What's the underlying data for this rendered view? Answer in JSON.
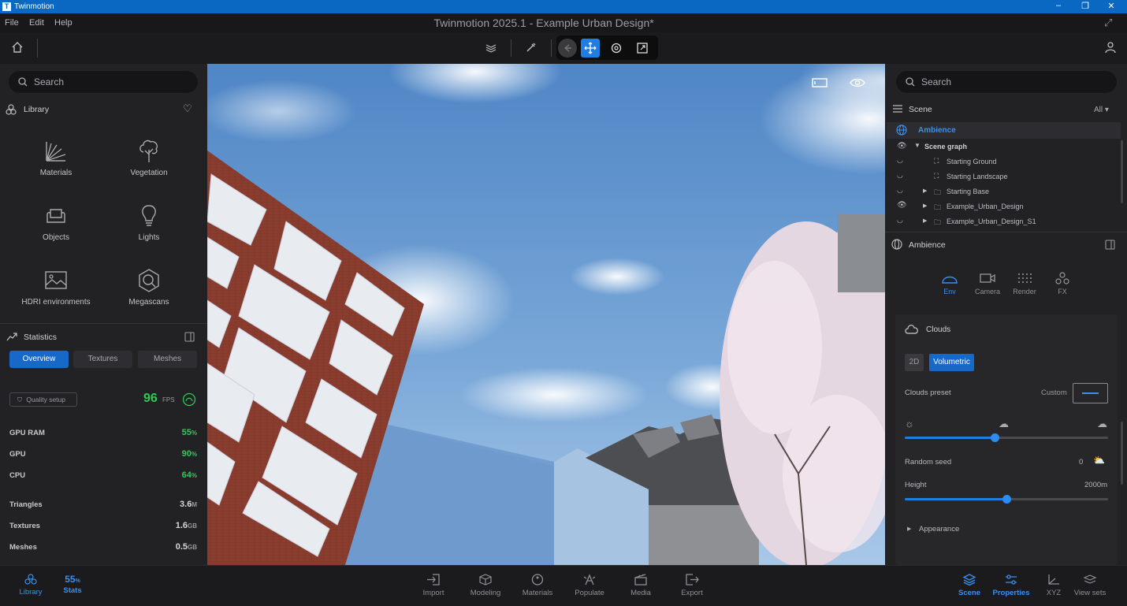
{
  "window": {
    "app_name": "Twinmotion",
    "document_title": "Twinmotion 2025.1 - Example Urban Design*"
  },
  "menu": [
    "File",
    "Edit",
    "Help"
  ],
  "left": {
    "search_placeholder": "Search",
    "library_title": "Library",
    "library_items": [
      "Materials",
      "Vegetation",
      "Objects",
      "Lights",
      "HDRI environments",
      "Megascans"
    ],
    "statistics_title": "Statistics",
    "tabs": [
      "Overview",
      "Textures",
      "Meshes"
    ],
    "quality_setup": "Quality setup",
    "fps_value": "96",
    "fps_unit": "FPS",
    "usage": [
      {
        "label": "GPU RAM",
        "value": "55",
        "unit": "%"
      },
      {
        "label": "GPU",
        "value": "90",
        "unit": "%"
      },
      {
        "label": "CPU",
        "value": "64",
        "unit": "%"
      }
    ],
    "counts": [
      {
        "label": "Triangles",
        "value": "3.6",
        "unit": "M"
      },
      {
        "label": "Textures",
        "value": "1.6",
        "unit": "GB"
      },
      {
        "label": "Meshes",
        "value": "0.5",
        "unit": "GB"
      }
    ]
  },
  "right": {
    "search_placeholder": "Search",
    "scene_title": "Scene",
    "filter": "All",
    "ambience_row": "Ambience",
    "tree": [
      "Scene graph",
      "Starting Ground",
      "Starting Landscape",
      "Starting Base",
      "Example_Urban_Design",
      "Example_Urban_Design_S1"
    ],
    "ambience_title": "Ambience",
    "prop_tabs": [
      "Env",
      "Camera",
      "Render",
      "FX"
    ],
    "clouds_title": "Clouds",
    "mode_2d": "2D",
    "mode_volumetric": "Volumetric",
    "clouds_preset_label": "Clouds preset",
    "clouds_preset_value": "Custom",
    "cloud_cover_fraction": 0.44,
    "random_seed_label": "Random seed",
    "random_seed_value": "0",
    "height_label": "Height",
    "height_value": "2000m",
    "height_fraction": 0.5,
    "appearance": "Appearance"
  },
  "bottom": {
    "left_items": [
      {
        "label": "Library"
      },
      {
        "label": "Stats",
        "value": "55",
        "unit": "%"
      }
    ],
    "center_items": [
      "Import",
      "Modeling",
      "Materials",
      "Populate",
      "Media",
      "Export"
    ],
    "right_items": [
      "Scene",
      "Properties",
      "XYZ",
      "View sets"
    ]
  },
  "colors": {
    "accent": "#1f7ee0",
    "green": "#2ecc57",
    "titlebar": "#0a67c2"
  }
}
